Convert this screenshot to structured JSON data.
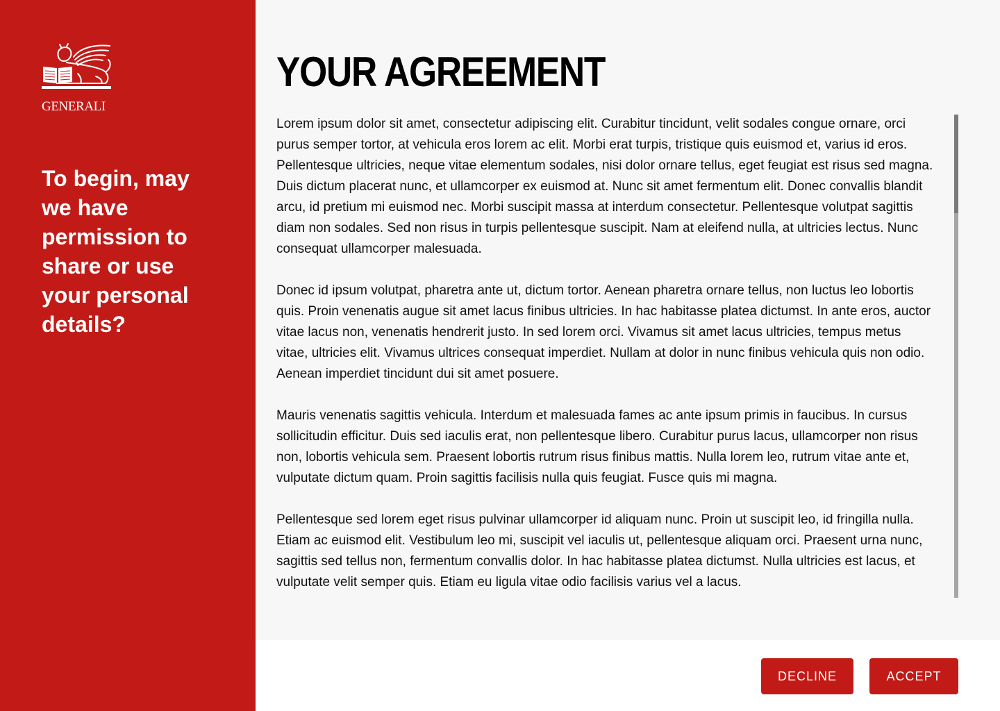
{
  "brand": {
    "name": "GENERALI",
    "primary_color": "#c21b17"
  },
  "sidebar": {
    "question": "To begin, may we have permission to share or use your personal details?"
  },
  "main": {
    "title": "YOUR AGREEMENT",
    "paragraphs": [
      "Lorem ipsum dolor sit amet, consectetur adipiscing elit. Curabitur tincidunt, velit sodales congue ornare, orci purus semper tortor, at vehicula eros lorem ac elit. Morbi erat turpis, tristique quis euismod et, varius id eros. Pellentesque ultricies, neque vitae elementum sodales, nisi dolor ornare tellus, eget feugiat est risus sed magna. Duis dictum placerat nunc, et ullamcorper ex euismod at. Nunc sit amet fermentum elit. Donec convallis blandit arcu, id pretium mi euismod nec. Morbi suscipit massa at interdum consectetur. Pellentesque volutpat sagittis diam non sodales. Sed non risus in turpis pellentesque suscipit. Nam at eleifend nulla, at ultricies lectus. Nunc consequat ullamcorper malesuada.",
      "Donec id ipsum volutpat, pharetra ante ut, dictum tortor. Aenean pharetra ornare tellus, non luctus leo lobortis quis. Proin venenatis augue sit amet lacus finibus ultricies. In hac habitasse platea dictumst. In ante eros, auctor vitae lacus non, venenatis hendrerit justo. In sed lorem orci. Vivamus sit amet lacus ultricies, tempus metus vitae, ultricies elit. Vivamus ultrices consequat imperdiet. Nullam at dolor in nunc finibus vehicula quis non odio. Aenean imperdiet tincidunt dui sit amet posuere.",
      "Mauris venenatis sagittis vehicula. Interdum et malesuada fames ac ante ipsum primis in faucibus. In cursus sollicitudin efficitur. Duis sed iaculis erat, non pellentesque libero. Curabitur purus lacus, ullamcorper non risus non, lobortis vehicula sem. Praesent lobortis rutrum risus finibus mattis. Nulla lorem leo, rutrum vitae ante et, vulputate dictum quam. Proin sagittis facilisis nulla quis feugiat. Fusce quis mi magna.",
      "Pellentesque sed lorem eget risus pulvinar ullamcorper id aliquam nunc. Proin ut suscipit leo, id fringilla nulla. Etiam ac euismod elit. Vestibulum leo mi, suscipit vel iaculis ut, pellentesque aliquam orci. Praesent urna nunc, sagittis sed tellus non, fermentum convallis dolor. In hac habitasse platea dictumst. Nulla ultricies est lacus, et vulputate velit semper quis. Etiam eu ligula vitae odio facilisis varius vel a lacus."
    ]
  },
  "actions": {
    "decline_label": "DECLINE",
    "accept_label": "ACCEPT"
  }
}
